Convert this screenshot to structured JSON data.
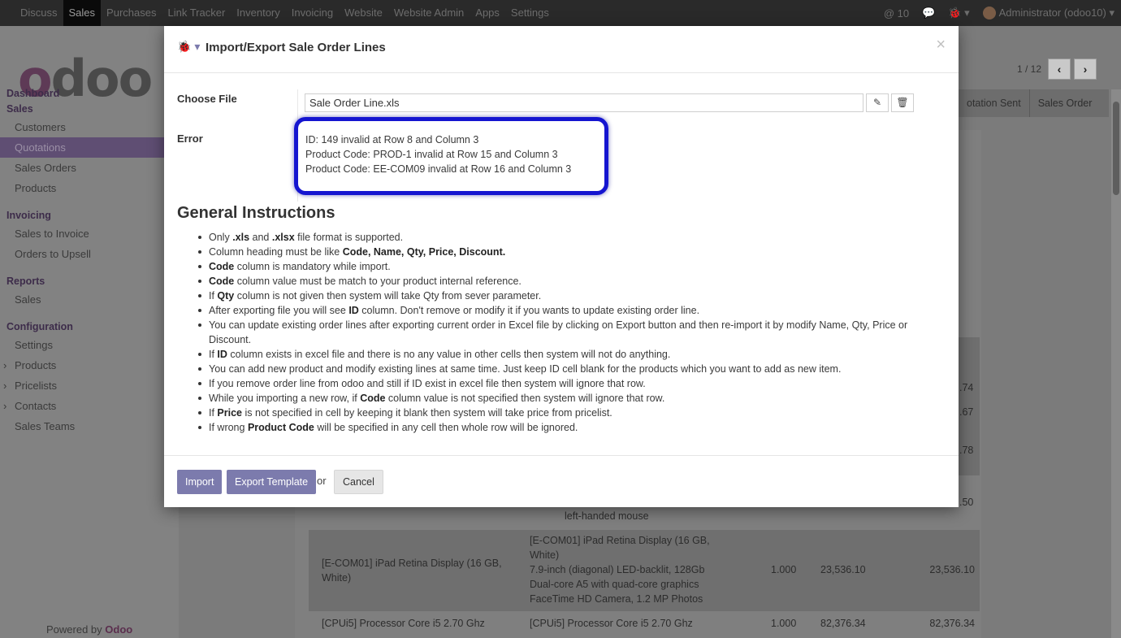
{
  "topbar": {
    "menu": [
      "Discuss",
      "Sales",
      "Purchases",
      "Link Tracker",
      "Inventory",
      "Invoicing",
      "Website",
      "Website Admin",
      "Apps",
      "Settings"
    ],
    "active_menu": "Sales",
    "notif_count": "10",
    "user": "Administrator (odoo10)"
  },
  "sidebar": {
    "logo": "odoo",
    "sections": [
      {
        "title": "Dashboard",
        "items": []
      },
      {
        "title": "Sales",
        "items": [
          "Customers",
          "Quotations",
          "Sales Orders",
          "Products"
        ]
      },
      {
        "title": "Invoicing",
        "items": [
          "Sales to Invoice",
          "Orders to Upsell"
        ]
      },
      {
        "title": "Reports",
        "items": [
          "Sales"
        ]
      },
      {
        "title": "Configuration",
        "items": [
          "Settings",
          "Products",
          "Pricelists",
          "Contacts",
          "Sales Teams"
        ]
      }
    ],
    "selected": "Quotations",
    "powered_prefix": "Powered by ",
    "powered_brand": "Odoo"
  },
  "main": {
    "pager": "1 / 12",
    "pager_prev": "‹",
    "pager_next": "›",
    "status_steps": [
      "otation Sent",
      "Sales Order"
    ],
    "totals_partial": [
      ".74",
      ".67",
      ".78",
      ".50"
    ],
    "lines": [
      {
        "desc_tail": "left-handed mouse"
      },
      {
        "product": "[E-COM01] iPad Retina Display (16 GB, White)",
        "description": "[E-COM01] iPad Retina Display (16 GB, White)\n7.9-inch (diagonal) LED-backlit, 128Gb\nDual-core A5 with quad-core graphics\nFaceTime HD Camera, 1.2 MP Photos",
        "qty": "1.000",
        "price": "23,536.10",
        "subtotal": "23,536.10"
      },
      {
        "product": "[CPUi5] Processor Core i5 2.70 Ghz",
        "description": "[CPUi5] Processor Core i5 2.70 Ghz",
        "qty": "1.000",
        "price": "82,376.34",
        "subtotal": "82,376.34"
      }
    ]
  },
  "modal": {
    "title": "Import/Export Sale Order Lines",
    "close": "×",
    "choose_file_label": "Choose File",
    "file_name": "Sale Order Line.xls",
    "error_label": "Error",
    "errors": [
      "ID: 149 invalid at Row 8 and Column 3",
      "Product Code: PROD-1 invalid at Row 15 and Column 3",
      "Product Code: EE-COM09 invalid at Row 16 and Column 3"
    ],
    "instructions_title": "General Instructions",
    "instructions": [
      "Only <b>.xls</b> and <b>.xlsx</b> file format is supported.",
      "Column heading must be like <b>Code, Name, Qty, Price, Discount.</b>",
      "<b>Code</b> column is mandatory while import.",
      "<b>Code</b> column value must be match to your product internal reference.",
      "If <b>Qty</b> column is not given then system will take Qty from sever parameter.",
      "After exporting file you will see <b>ID</b> column. Don't remove or modify it if you wants to update existing order line.",
      "You can update existing order lines after exporting current order in Excel file by clicking on Export button and then re-import it by modify Name, Qty, Price or Discount.",
      "If <b>ID</b> column exists in excel file and there is no any value in other cells then system will not do anything.",
      "You can add new product and modify existing lines at same time. Just keep ID cell blank for the products which you want to add as new item.",
      "If you remove order line from odoo and still if ID exist in excel file then system will ignore that row.",
      "While you importing a new row, if <b>Code</b> column value is not specified then system will ignore that row.",
      "If <b>Price</b> is not specified in cell by keeping it blank then system will take price from pricelist.",
      "If wrong <b>Product Code</b> will be specified in any cell then whole row will be ignored."
    ],
    "import_label": "Import",
    "export_label": "Export Template",
    "or_label": "or",
    "cancel_label": "Cancel"
  },
  "colors": {
    "accent": "#7c7bad",
    "highlight_border": "#1515d0"
  }
}
